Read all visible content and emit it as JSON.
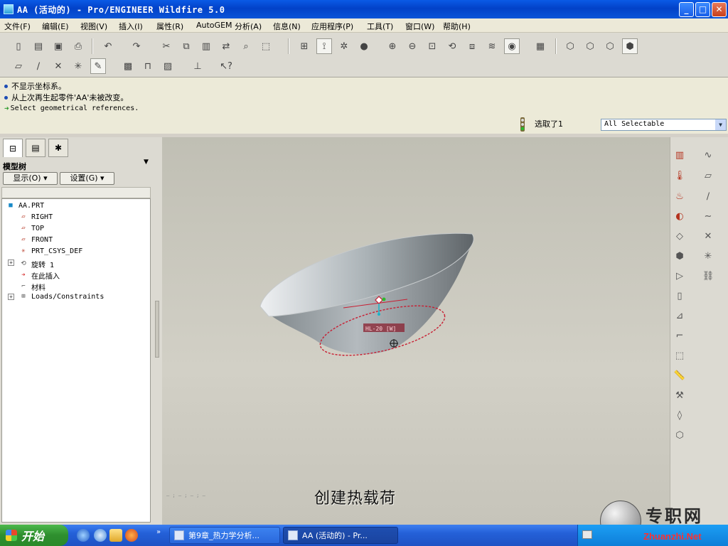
{
  "window": {
    "title": "AA (活动的) - Pro/ENGINEER Wildfire 5.0",
    "buttons": {
      "minimize": "_",
      "maximize": "□",
      "close": "✕"
    }
  },
  "menu": [
    "文件(F)",
    "编辑(E)",
    "视图(V)",
    "插入(I)",
    "属性(R)",
    "AutoGEM",
    "分析(A)",
    "信息(N)",
    "应用程序(P)",
    "工具(T)",
    "窗口(W)",
    "帮助(H)"
  ],
  "messages": {
    "line1": "不显示坐标系。",
    "line2": "从上次再生起零件'AA'未被改变。",
    "line3": "Select geometrical references."
  },
  "selection": {
    "status": "选取了1",
    "filter": "All Selectable"
  },
  "left_panel": {
    "title": "模型树",
    "show_button": "显示(O) ▾",
    "settings_button": "设置(G) ▾",
    "tree": [
      {
        "label": "AA.PRT",
        "icon": "part-icon"
      },
      {
        "label": "RIGHT",
        "icon": "datum-plane-icon"
      },
      {
        "label": "TOP",
        "icon": "datum-plane-icon"
      },
      {
        "label": "FRONT",
        "icon": "datum-plane-icon"
      },
      {
        "label": "PRT_CSYS_DEF",
        "icon": "csys-icon"
      },
      {
        "label": "旋转 1",
        "icon": "revolve-icon",
        "expandable": true
      },
      {
        "label": "在此插入",
        "icon": "insert-here-icon"
      },
      {
        "label": "材料",
        "icon": "material-icon"
      },
      {
        "label": "Loads/Constraints",
        "icon": "loads-icon",
        "expandable": true
      }
    ]
  },
  "viewport": {
    "annotation": "HL-20 [W]",
    "caption": "创建热载荷"
  },
  "logo": {
    "text": "专职网",
    "url": "Zhuanzhi.Net"
  },
  "taskbar": {
    "start": "开始",
    "tasks": [
      "第9章_热力学分析...",
      "AA (活动的) - Pr..."
    ]
  },
  "colors": {
    "titlebar": "#0a5ae6",
    "taskbar": "#2460d8",
    "accent_red": "#c81e32"
  }
}
